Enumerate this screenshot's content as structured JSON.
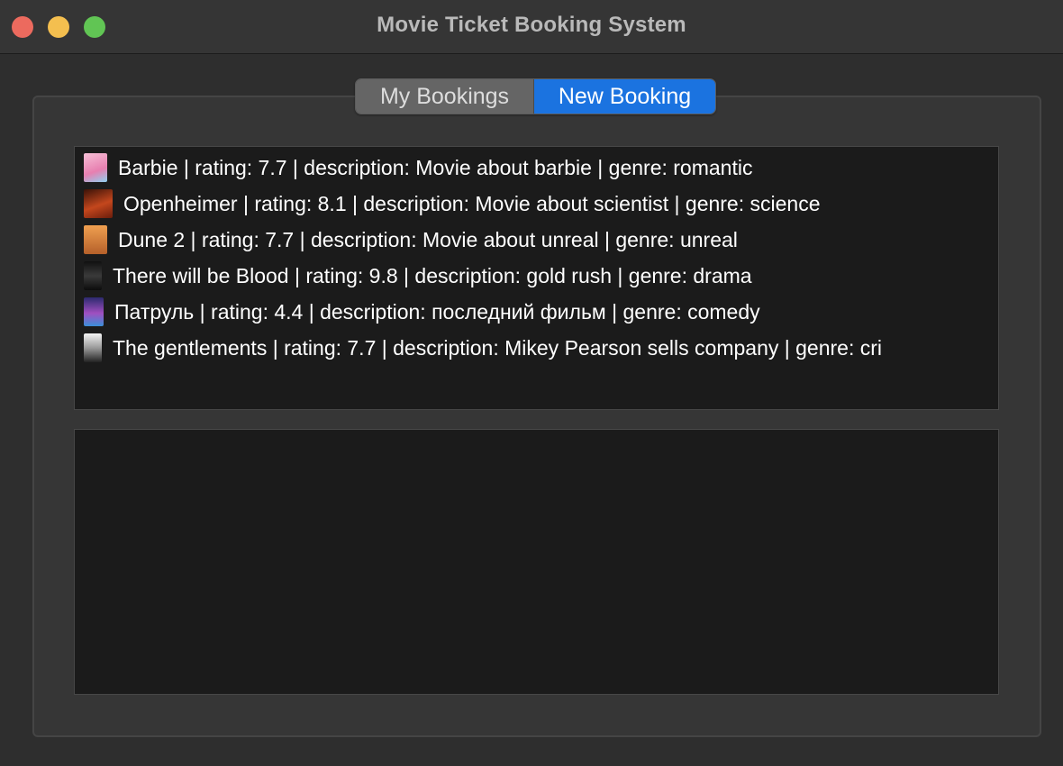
{
  "window": {
    "title": "Movie Ticket Booking System"
  },
  "tabs": [
    {
      "label": "My Bookings",
      "active": false
    },
    {
      "label": "New Booking",
      "active": true
    }
  ],
  "movies": [
    {
      "text": "Barbie  |  rating: 7.7  |  description: Movie about barbie  |  genre: romantic",
      "poster_icon": "barbie-poster-icon",
      "poster_color": "#f2a4c4"
    },
    {
      "text": "Openheimer  |  rating: 8.1  |  description: Movie about scientist  |  genre: science",
      "poster_icon": "openheimer-poster-icon",
      "poster_color": "#b3411f"
    },
    {
      "text": "Dune 2  |  rating: 7.7  |  description: Movie about unreal  |  genre: unreal",
      "poster_icon": "dune-poster-icon",
      "poster_color": "#d98a3b"
    },
    {
      "text": "There will be Blood  |  rating: 9.8  |  description: gold rush  |  genre: drama",
      "poster_icon": "blood-poster-icon",
      "poster_color": "#2a2a2a"
    },
    {
      "text": "Патруль  |  rating: 4.4  |  description: последний фильм  |  genre: comedy",
      "poster_icon": "patrol-poster-icon",
      "poster_color": "#6b3fa0"
    },
    {
      "text": "The gentlements  |  rating: 7.7  |  description: Mikey Pearson sells company  |  genre: cri",
      "poster_icon": "gentlemen-poster-icon",
      "poster_color": "#e8e8e8"
    }
  ],
  "colors": {
    "accent": "#1b73e0",
    "close": "#ec6a5e",
    "minimize": "#f4bf4f",
    "maximize": "#61c554"
  }
}
